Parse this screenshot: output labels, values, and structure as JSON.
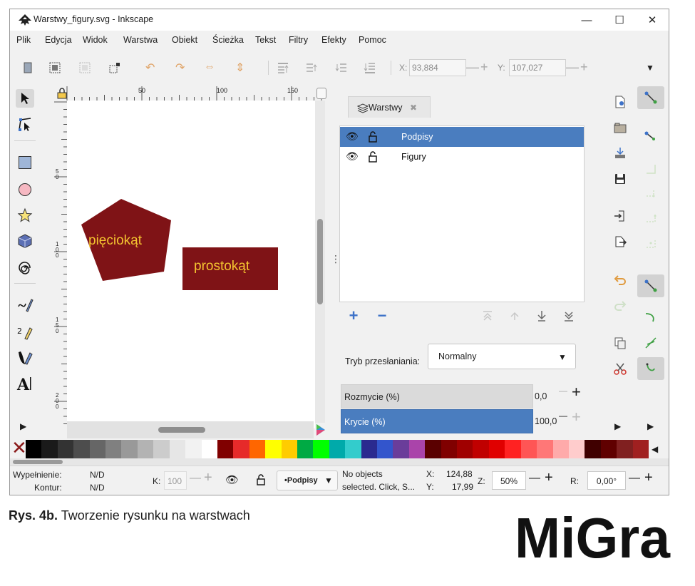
{
  "window": {
    "title": "Warstwy_figury.svg - Inkscape",
    "minimize": "—",
    "maximize": "☐",
    "close": "✕"
  },
  "menu": [
    "Plik",
    "Edycja",
    "Widok",
    "Warstwa",
    "Obiekt",
    "Ścieżka",
    "Tekst",
    "Filtry",
    "Efekty",
    "Pomoc"
  ],
  "toolbar": {
    "x_label": "X:",
    "x_value": "93,884",
    "y_label": "Y:",
    "y_value": "107,027",
    "overflow_icon": "▼"
  },
  "ruler": {
    "top_ticks": [
      "50",
      "100",
      "150"
    ],
    "left_ticks": [
      "5\n0",
      "1\n0\n0",
      "1\n5\n0",
      "2\n0\n0"
    ]
  },
  "canvas": {
    "shape1_text": "pięciokąt",
    "shape2_text": "prostokąt",
    "shape_fill": "#7f1316",
    "text_color": "#f4c430"
  },
  "layers_panel": {
    "tab_label": "Warstwy",
    "tab_close": "✖",
    "layers": [
      {
        "name": "Podpisy",
        "selected": true
      },
      {
        "name": "Figury",
        "selected": false
      }
    ],
    "blend_label": "Tryb przesłaniania:",
    "blend_value": "Normalny",
    "blur_label": "Rozmycie (%)",
    "blur_value": "0,0",
    "opacity_label": "Krycie (%)",
    "opacity_value": "100,0",
    "selected_color": "#4a7dbf"
  },
  "palette": {
    "none_icon": "✕",
    "scroll_icon": "◀",
    "colors": [
      "#000000",
      "#1a1a1a",
      "#333333",
      "#4d4d4d",
      "#666666",
      "#808080",
      "#999999",
      "#b3b3b3",
      "#cccccc",
      "#e6e6e6",
      "#f2f2f2",
      "#ffffff",
      "#800000",
      "#e62a2a",
      "#ff6600",
      "#ffff00",
      "#ffcc00",
      "#00aa44",
      "#00ff00",
      "#00aaaa",
      "#33cccc",
      "#2a2a8f",
      "#3355cc",
      "#6a3d9a",
      "#aa44aa",
      "#5a0000",
      "#800000",
      "#a00000",
      "#c00000",
      "#e00000",
      "#ff2222",
      "#ff5555",
      "#ff7777",
      "#ffaaaa",
      "#ffcccc",
      "#400000",
      "#600000",
      "#802020",
      "#a02020"
    ]
  },
  "status": {
    "fill_label": "Wypełnienie:",
    "fill_value": "N/D",
    "stroke_label": "Kontur:",
    "stroke_value": "N/D",
    "k_label": "K:",
    "k_value": "100",
    "layer_value": "•Podpisy",
    "message_line1": "No objects",
    "message_line2": "selected. Click, S...",
    "x_label": "X:",
    "x_value": "124,88",
    "y_label": "Y:",
    "y_value": "17,99",
    "z_label": "Z:",
    "zoom_value": "50%",
    "r_label": "R:",
    "rotation_value": "0,00°"
  },
  "caption": {
    "label": "Rys. 4b.",
    "text": " Tworzenie rysunku na warstwach"
  },
  "brand": "MiGra"
}
